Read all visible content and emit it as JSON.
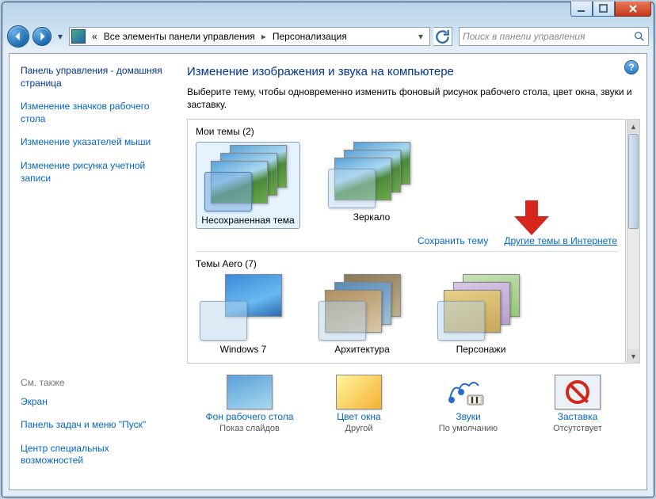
{
  "title_buttons": {
    "min": "–",
    "max": "□",
    "close": "✕"
  },
  "breadcrumb": {
    "prefix": "«",
    "item1": "Все элементы панели управления",
    "arrow": "▸",
    "item2": "Персонализация"
  },
  "search_placeholder": "Поиск в панели управления",
  "sidebar": {
    "home": "Панель управления - домашняя страница",
    "links": [
      "Изменение значков рабочего стола",
      "Изменение указателей мыши",
      "Изменение рисунка учетной записи"
    ],
    "see_also": "См. также",
    "see_links": [
      "Экран",
      "Панель задач и меню \"Пуск\"",
      "Центр специальных возможностей"
    ]
  },
  "main": {
    "heading": "Изменение изображения и звука на компьютере",
    "desc": "Выберите тему, чтобы одновременно изменить фоновый рисунок рабочего стола, цвет окна, звуки и заставку.",
    "group_my": "Мои темы (2)",
    "themes_my": [
      {
        "name": "Несохраненная тема"
      },
      {
        "name": "Зеркало"
      }
    ],
    "link_save": "Сохранить тему",
    "link_online": "Другие темы в Интернете",
    "group_aero": "Темы Aero (7)",
    "themes_aero": [
      {
        "name": "Windows 7"
      },
      {
        "name": "Архитектура"
      },
      {
        "name": "Персонажи"
      }
    ]
  },
  "bottom": [
    {
      "label": "Фон рабочего стола",
      "sub": "Показ слайдов"
    },
    {
      "label": "Цвет окна",
      "sub": "Другой"
    },
    {
      "label": "Звуки",
      "sub": "По умолчанию"
    },
    {
      "label": "Заставка",
      "sub": "Отсутствует"
    }
  ],
  "help": "?"
}
